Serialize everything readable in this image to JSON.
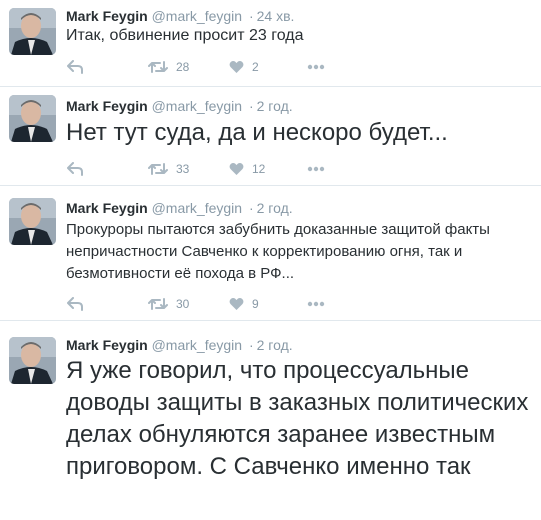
{
  "tweets": [
    {
      "name": "Mark Feygin",
      "handle": "@mark_feygin",
      "time": "24 хв.",
      "text": "Итак, обвинение просит 23 года",
      "retweets": "28",
      "likes": "2"
    },
    {
      "name": "Mark Feygin",
      "handle": "@mark_feygin",
      "time": "2 год.",
      "text": "Нет тут суда, да и нескоро будет...",
      "retweets": "33",
      "likes": "12"
    },
    {
      "name": "Mark Feygin",
      "handle": "@mark_feygin",
      "time": "2 год.",
      "text": "Прокуроры пытаются забубнить доказанные защитой факты непричастности Савченко к корректированию огня, так и безмотивности её похода в РФ...",
      "retweets": "30",
      "likes": "9"
    },
    {
      "name": "Mark Feygin",
      "handle": "@mark_feygin",
      "time": "2 год.",
      "text": "Я уже говорил, что процессуальные доводы защиты в заказных политических делах обнуляются заранее известным приговором. С Савченко именно так"
    }
  ],
  "separator": "·",
  "icons": {
    "avatar": "avatar-photo",
    "reply": "reply-icon",
    "retweet": "retweet-icon",
    "like": "heart-icon",
    "more": "more-dots-icon"
  },
  "colors": {
    "name": "#292f33",
    "meta": "#8899a6",
    "icon": "#aab8c2",
    "divider": "#e1e8ed"
  }
}
